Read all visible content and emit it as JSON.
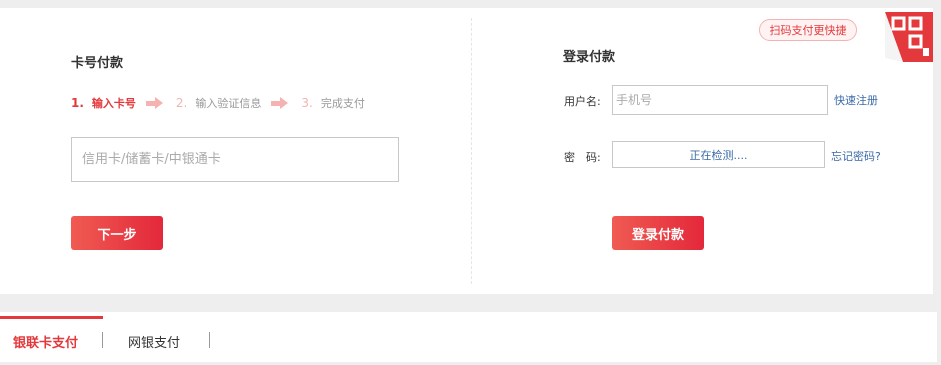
{
  "card_payment": {
    "title": "卡号付款",
    "steps": [
      {
        "num": "1.",
        "label": "输入卡号"
      },
      {
        "num": "2.",
        "label": "输入验证信息"
      },
      {
        "num": "3.",
        "label": "完成支付"
      }
    ],
    "card_input_placeholder": "信用卡/储蓄卡/中银通卡",
    "next_button": "下一步"
  },
  "login_payment": {
    "title": "登录付款",
    "username_label": "用户名:",
    "username_placeholder": "手机号",
    "register_link": "快速注册",
    "password_label": "密　码:",
    "password_status": "正在检测....",
    "forgot_link": "忘记密码?",
    "login_button": "登录付款"
  },
  "qr": {
    "tip": "扫码支付更快捷"
  },
  "tabs": [
    {
      "label": "银联卡支付",
      "active": true
    },
    {
      "label": "网银支付",
      "active": false
    }
  ],
  "colors": {
    "accent": "#e4393c",
    "link": "#3b6aa8"
  }
}
